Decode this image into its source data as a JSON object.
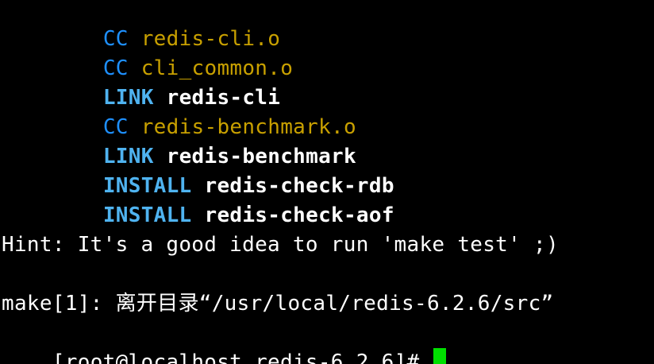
{
  "colors": {
    "background": "#000000",
    "cc_prefix": "#1e90ff",
    "object_file": "#c8a000",
    "action_keyword": "#4fb3f0",
    "target": "#ffffff",
    "cursor": "#00e000"
  },
  "terminal": {
    "build_lines": [
      {
        "prefix": "CC",
        "name": "redis-cli.o",
        "kind": "compile"
      },
      {
        "prefix": "CC",
        "name": "cli_common.o",
        "kind": "compile"
      },
      {
        "prefix": "LINK",
        "name": "redis-cli",
        "kind": "action"
      },
      {
        "prefix": "CC",
        "name": "redis-benchmark.o",
        "kind": "compile"
      },
      {
        "prefix": "LINK",
        "name": "redis-benchmark",
        "kind": "action"
      },
      {
        "prefix": "INSTALL",
        "name": "redis-check-rdb",
        "kind": "action"
      },
      {
        "prefix": "INSTALL",
        "name": "redis-check-aof",
        "kind": "action"
      }
    ],
    "hint_line": "Hint: It's a good idea to run 'make test' ;)",
    "make_leave_line": "make[1]: 离开目录“/usr/local/redis-6.2.6/src”",
    "prompt": "[root@localhost redis-6.2.6]# "
  }
}
